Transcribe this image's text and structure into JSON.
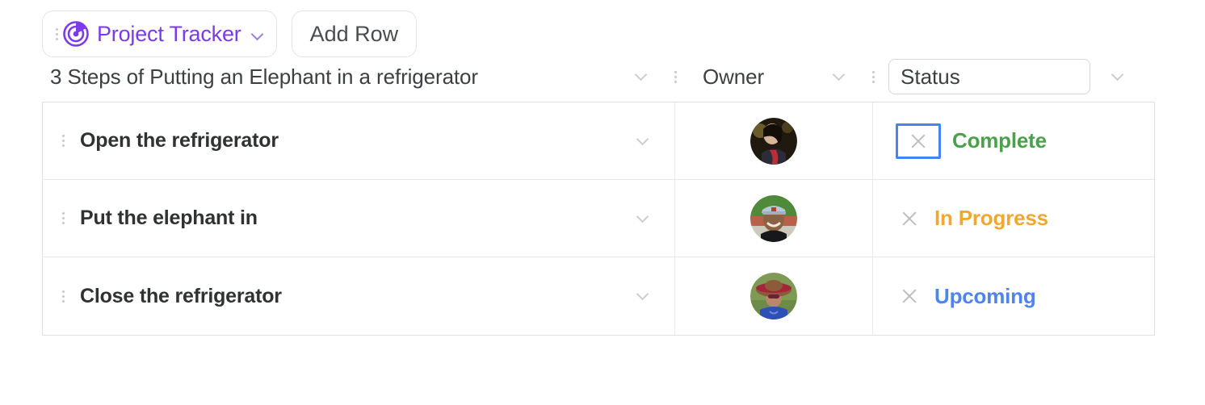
{
  "toolbar": {
    "brand_label": "Project Tracker",
    "brand_icon": "radar-target-icon",
    "brand_color": "#7c3aed",
    "brand_chevron_icon": "chevron-down-icon",
    "drag_handle_icon": "drag-handle-dots-icon",
    "add_row_label": "Add Row"
  },
  "columns": {
    "task_header": "3 Steps of Putting an Elephant in a refrigerator",
    "owner_header": "Owner",
    "status_header": "Status",
    "task_chevron_icon": "chevron-down-icon",
    "owner_chevron_icon": "chevron-down-icon",
    "status_chevron_icon": "chevron-down-icon",
    "separator_icon": "column-separator-dots-icon"
  },
  "rows": [
    {
      "task": "Open the refrigerator",
      "owner_avatar": "avatar-person-dark-scarf",
      "status": "Complete",
      "status_color": "#4ba14b",
      "remove_icon": "close-x-icon",
      "remove_focused": true,
      "row_handle_icon": "drag-handle-dots-icon",
      "row_chevron_icon": "chevron-down-icon"
    },
    {
      "task": "Put the elephant in",
      "owner_avatar": "avatar-person-cap-green",
      "status": "In Progress",
      "status_color": "#efa832",
      "remove_icon": "close-x-icon",
      "remove_focused": false,
      "row_handle_icon": "drag-handle-dots-icon",
      "row_chevron_icon": "chevron-down-icon"
    },
    {
      "task": "Close the refrigerator",
      "owner_avatar": "avatar-person-red-hat",
      "status": "Upcoming",
      "status_color": "#4f83f1",
      "remove_icon": "close-x-icon",
      "remove_focused": false,
      "row_handle_icon": "drag-handle-dots-icon",
      "row_chevron_icon": "chevron-down-icon"
    }
  ]
}
